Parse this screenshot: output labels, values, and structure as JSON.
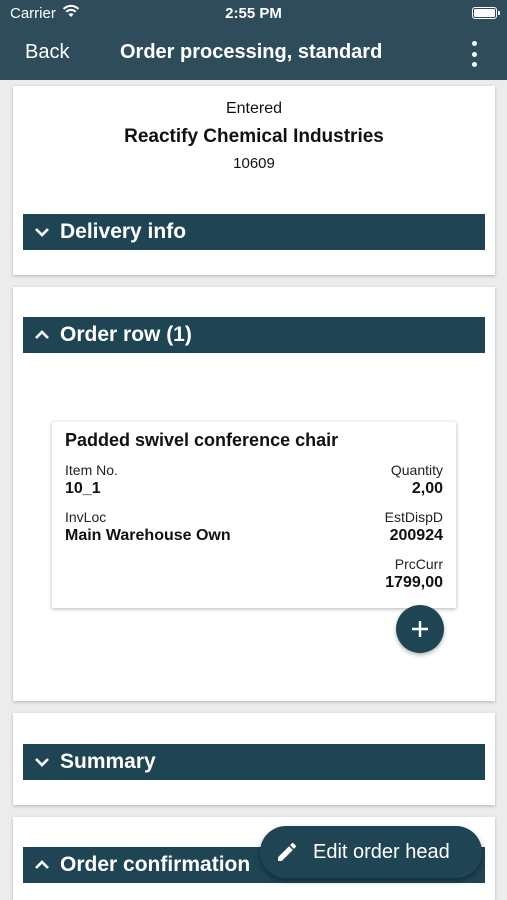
{
  "status_bar": {
    "carrier": "Carrier",
    "time": "2:55 PM"
  },
  "nav": {
    "back_label": "Back",
    "title": "Order processing, standard",
    "more_icon": "more-vertical-icon"
  },
  "order_head": {
    "status": "Entered",
    "customer": "Reactify Chemical Industries",
    "number": "10609"
  },
  "sections": {
    "delivery": {
      "label": "Delivery info",
      "expanded": false
    },
    "order_row": {
      "label": "Order row (1)",
      "expanded": true
    },
    "summary": {
      "label": "Summary",
      "expanded": false
    },
    "confirmation": {
      "label": "Order confirmation",
      "expanded": true
    }
  },
  "order_rows": [
    {
      "name": "Padded swivel conference chair",
      "item_no_label": "Item No.",
      "item_no": "10_1",
      "quantity_label": "Quantity",
      "quantity": "2,00",
      "invloc_label": "InvLoc",
      "invloc": "Main Warehouse Own",
      "estdisp_label": "EstDispD",
      "estdisp": "200924",
      "prccurr_label": "PrcCurr",
      "prccurr": "1799,00"
    }
  ],
  "fab": {
    "edit_label": "Edit order head",
    "add_icon": "plus-icon",
    "edit_icon": "pencil-icon"
  },
  "colors": {
    "primary": "#1f4555",
    "navbar": "#2e4c5a",
    "background": "#ececec"
  }
}
